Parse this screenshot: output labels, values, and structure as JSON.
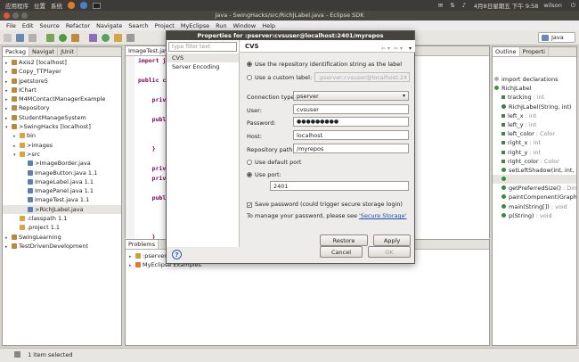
{
  "system_panel": {
    "apps": "应用程序",
    "places": "位置",
    "system": "系统",
    "clock": "4月8日星期五 下午 9:58",
    "user": "wilson"
  },
  "window": {
    "title": "Java - SwingHacks/src/RichJLabel.java - Eclipse SDK"
  },
  "menubar": [
    "File",
    "Edit",
    "Source",
    "Refactor",
    "Navigate",
    "Search",
    "Project",
    "MyEclipse",
    "Run",
    "Window",
    "Help"
  ],
  "perspective": {
    "label": "Java"
  },
  "left_view": {
    "tabs": [
      "Packag",
      "Navigat",
      "JUnit"
    ],
    "tree": [
      {
        "label": "Axis2  [localhost]",
        "indent": 0,
        "arrow": "▸"
      },
      {
        "label": "Copy_TTPlayer",
        "indent": 0,
        "arrow": "▸"
      },
      {
        "label": "jpetstore5",
        "indent": 0,
        "arrow": "▸"
      },
      {
        "label": "IChart",
        "indent": 0,
        "arrow": "▸"
      },
      {
        "label": "M4MContactManagerExample",
        "indent": 0,
        "arrow": "▸"
      },
      {
        "label": "Repository",
        "indent": 0,
        "arrow": "▸"
      },
      {
        "label": "StudentManageSystem",
        "indent": 0,
        "arrow": "▸"
      },
      {
        "label": ">SwingHacks  [localhost]",
        "indent": 0,
        "arrow": "▾"
      },
      {
        "label": "bin",
        "indent": 1,
        "arrow": "▸"
      },
      {
        "label": ">images",
        "indent": 1,
        "arrow": "▸"
      },
      {
        "label": ">src",
        "indent": 1,
        "arrow": "▾"
      },
      {
        "label": ">ImageBorder.java",
        "indent": 2,
        "arrow": ""
      },
      {
        "label": "ImageButton.java  1.1",
        "indent": 2,
        "arrow": ""
      },
      {
        "label": "ImageLabel.java  1.1",
        "indent": 2,
        "arrow": ""
      },
      {
        "label": "ImagePanel.java  1.1",
        "indent": 2,
        "arrow": ""
      },
      {
        "label": "ImageTest.java  1.1",
        "indent": 2,
        "arrow": ""
      },
      {
        "label": ">RichJLabel.java",
        "indent": 2,
        "arrow": "",
        "selected": true
      },
      {
        "label": ".classpath  1.1",
        "indent": 1,
        "arrow": ""
      },
      {
        "label": ".project  1.1",
        "indent": 1,
        "arrow": ""
      },
      {
        "label": "SwingLearning",
        "indent": 0,
        "arrow": "▸"
      },
      {
        "label": "TestDrivenDevelopment",
        "indent": 0,
        "arrow": "▸"
      }
    ]
  },
  "editor": {
    "tabs": [
      "ImageTest.java"
    ],
    "lines": [
      "import j",
      "",
      "public c",
      "",
      "    priva",
      "",
      "    publi",
      "        s",
      "        t",
      "    }",
      "",
      "    priva",
      "    priva",
      "",
      "    publi",
      "        i",
      "        i",
      "        i",
      "    }",
      "",
      "    publi"
    ]
  },
  "bottom_view": {
    "tabs": [
      "Problems"
    ],
    "rows": [
      ":pserver:cv",
      "MyEclipse Examples"
    ]
  },
  "outline": {
    "tabs": [
      "Outline",
      "Properti"
    ],
    "items": [
      {
        "label": "import declarations",
        "kind": "import",
        "indent": 0
      },
      {
        "label": "RichJLabel",
        "kind": "class",
        "indent": 0
      },
      {
        "label": "tracking",
        "type": ": int",
        "kind": "field",
        "indent": 1
      },
      {
        "label": "RichJLabel(String, int)",
        "kind": "ctor",
        "indent": 1
      },
      {
        "label": "left_x",
        "type": ": int",
        "kind": "field",
        "indent": 1
      },
      {
        "label": "left_y",
        "type": ": int",
        "kind": "field",
        "indent": 1
      },
      {
        "label": "left_color",
        "type": ": Color",
        "kind": "field",
        "indent": 1
      },
      {
        "label": "right_x",
        "type": ": int",
        "kind": "field",
        "indent": 1
      },
      {
        "label": "right_y",
        "type": ": int",
        "kind": "field",
        "indent": 1
      },
      {
        "label": "right_color",
        "type": ": Color",
        "kind": "field",
        "indent": 1
      },
      {
        "label": "setLeftShadow(int, int, Colo",
        "kind": "method",
        "indent": 1
      },
      {
        "label": "",
        "kind": "method",
        "indent": 1
      },
      {
        "label": "getPreferredSize()",
        "type": ": Dimen",
        "kind": "method",
        "indent": 1
      },
      {
        "label": "paintComponent(Graphics)",
        "kind": "method",
        "indent": 1
      },
      {
        "label": "main(String[])",
        "type": ": void",
        "kind": "method",
        "indent": 1
      },
      {
        "label": "p(String)",
        "type": ": void",
        "kind": "method",
        "indent": 1
      }
    ]
  },
  "status": {
    "text": "1 item selected"
  },
  "dialog": {
    "title": "Properties for :pserver:cvsuser@localhost:2401/myrepos",
    "filter_placeholder": "type filter text",
    "nav": [
      "CVS",
      "Server Encoding"
    ],
    "page_title": "CVS",
    "opt_repo_id": "Use the repository identification string as the label",
    "opt_custom": "Use a custom label:",
    "custom_value": ":pserver:cvsuser@localhost:24",
    "conn_type_label": "Connection type:",
    "conn_type_value": "pserver",
    "user_label": "User:",
    "user_value": "cvsuser",
    "password_label": "Password:",
    "password_value": "●●●●●●●●●",
    "host_label": "Host:",
    "host_value": "localhost",
    "repo_path_label": "Repository path:",
    "repo_path_value": "/myrepos",
    "default_port": "Use default port",
    "use_port": "Use port:",
    "port_value": "2401",
    "save_password": "Save password (could trigger secure storage login)",
    "manage_text": "To manage your password, please see",
    "secure_storage": "'Secure Storage'",
    "restore_defaults": "Restore Defaults",
    "apply": "Apply",
    "cancel": "Cancel",
    "ok": "OK"
  },
  "colors": {
    "accent": "#e07a2e",
    "selection": "#e7e5e1",
    "link": "#1a4fb3"
  }
}
